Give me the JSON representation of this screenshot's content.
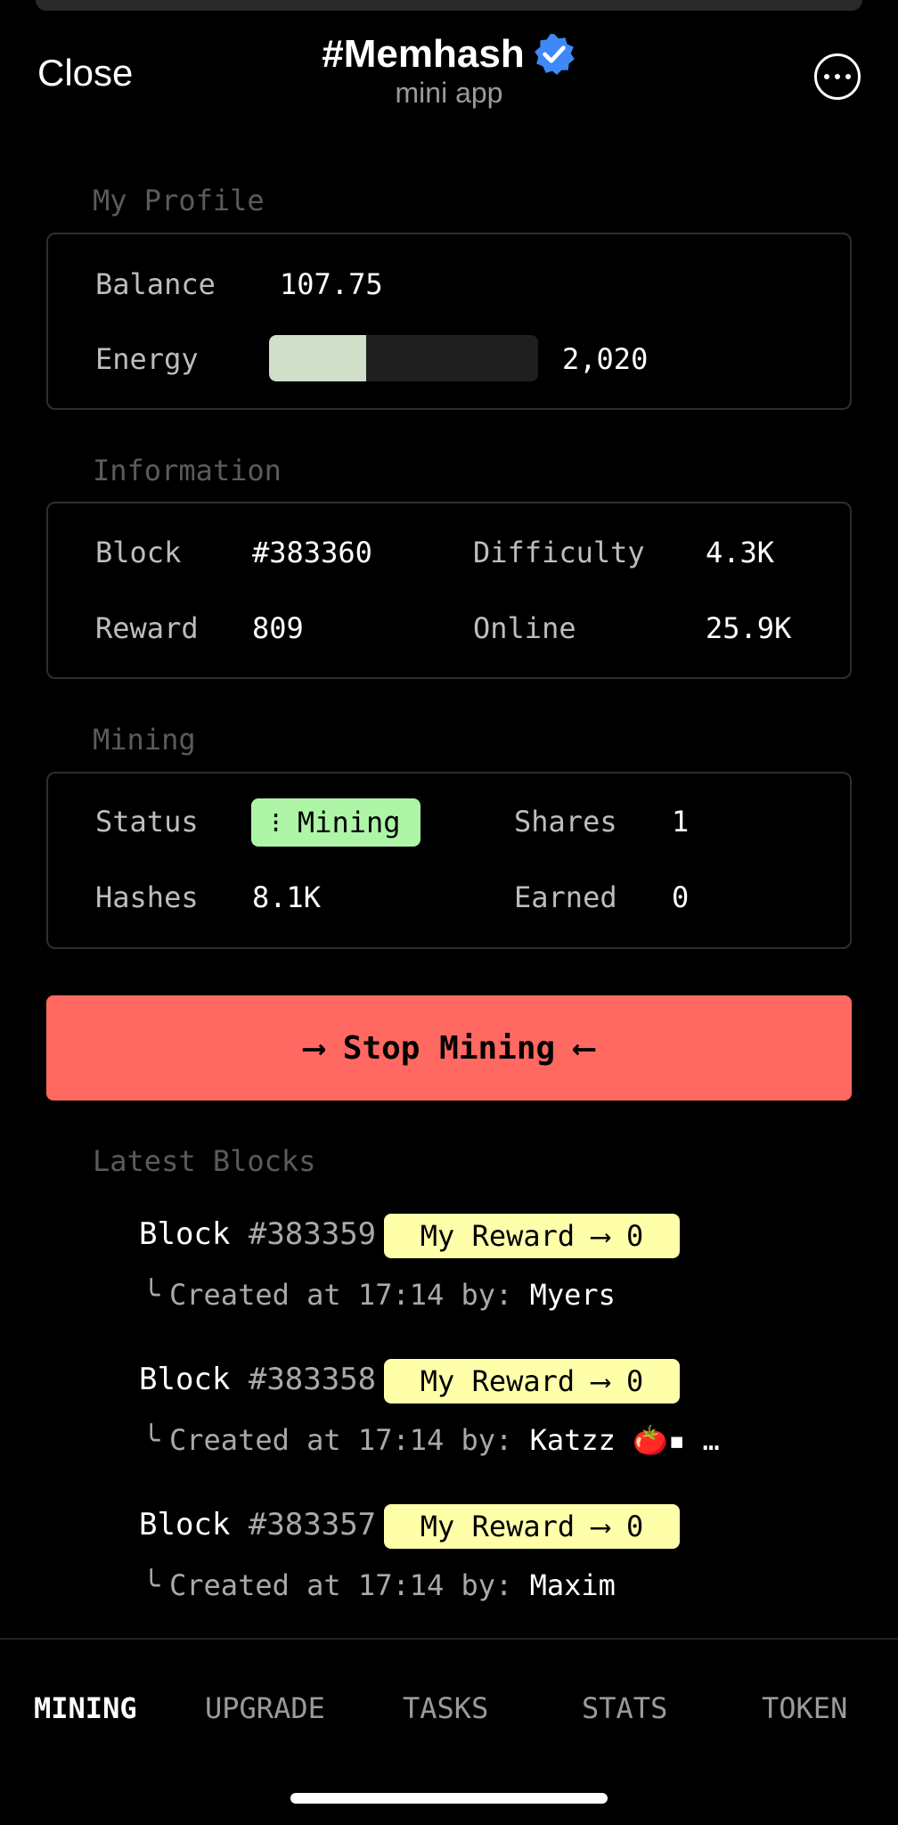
{
  "header": {
    "close_label": "Close",
    "title": "#Memhash",
    "subtitle": "mini app",
    "verified_color": "#3e88f7"
  },
  "profile": {
    "section_label": "My Profile",
    "balance_label": "Balance",
    "balance_value": "107.75",
    "energy_label": "Energy",
    "energy_value": "2,020",
    "energy_fraction": 0.36
  },
  "information": {
    "section_label": "Information",
    "block_label": "Block",
    "block_value": "#383360",
    "difficulty_label": "Difficulty",
    "difficulty_value": "4.3K",
    "reward_label": "Reward",
    "reward_value": "809",
    "online_label": "Online",
    "online_value": "25.9K"
  },
  "mining": {
    "section_label": "Mining",
    "status_label": "Status",
    "status_value": "⁝ Mining",
    "shares_label": "Shares",
    "shares_value": "1",
    "hashes_label": "Hashes",
    "hashes_value": "8.1K",
    "earned_label": "Earned",
    "earned_value": "0",
    "status_color": "#aef5a8"
  },
  "stop_button": {
    "label": "⟶ Stop Mining ⟵",
    "color": "#ff6961"
  },
  "latest_blocks": {
    "section_label": "Latest Blocks",
    "items": [
      {
        "prefix": "Block",
        "number": "#383359",
        "reward": "My Reward ⟶ 0",
        "created": "Created at 17:14 by:",
        "by": "Myers"
      },
      {
        "prefix": "Block",
        "number": "#383358",
        "reward": "My Reward ⟶ 0",
        "created": "Created at 17:14 by:",
        "by": "Katzz 🍅▪ …"
      },
      {
        "prefix": "Block",
        "number": "#383357",
        "reward": "My Reward ⟶ 0",
        "created": "Created at 17:14 by:",
        "by": "Maxim"
      }
    ]
  },
  "nav": {
    "items": [
      "MINING",
      "UPGRADE",
      "TASKS",
      "STATS",
      "TOKEN"
    ],
    "active": "MINING"
  }
}
